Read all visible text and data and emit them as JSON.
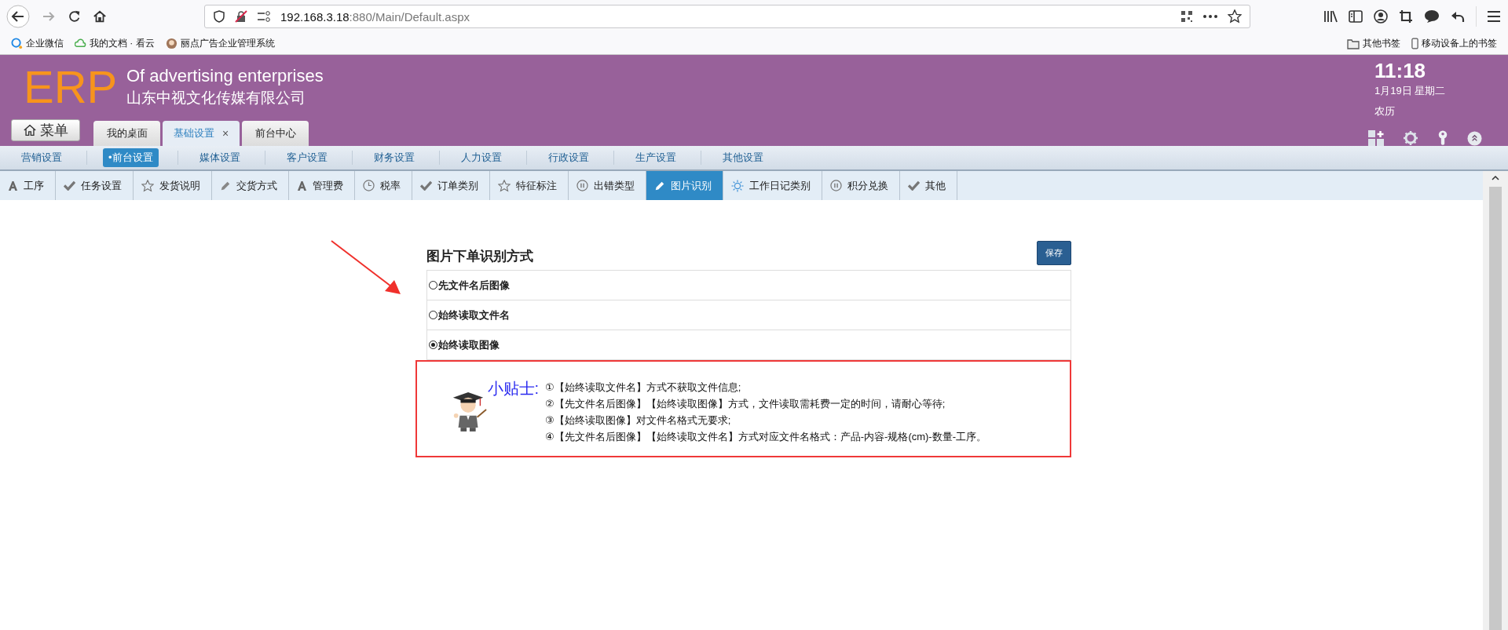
{
  "browser": {
    "url_host": "192.168.3.18",
    "url_path": ":880/Main/Default.aspx",
    "bookmarks": [
      {
        "label": "企业微信",
        "kind": "chat"
      },
      {
        "label": "我的文档 · 看云",
        "kind": "cloud"
      },
      {
        "label": "丽点广告企业管理系统",
        "kind": "site"
      }
    ],
    "bookmarks_right": [
      {
        "label": "其他书签",
        "kind": "folder"
      },
      {
        "label": "移动设备上的书签",
        "kind": "phone"
      }
    ]
  },
  "header": {
    "logo": "ERP",
    "title": "Of advertising enterprises",
    "company": "山东中视文化传媒有限公司",
    "time": "11:18",
    "date": "1月19日 星期二",
    "lunar": "农历",
    "menu_button": "菜单"
  },
  "tabs": [
    {
      "label": "我的桌面",
      "selected": false
    },
    {
      "label": "基础设置",
      "selected": true,
      "close": "×"
    },
    {
      "label": "前台中心",
      "selected": false
    }
  ],
  "nav": [
    {
      "label": "营销设置",
      "selected": false
    },
    {
      "label": "•前台设置",
      "selected": true
    },
    {
      "label": "媒体设置",
      "selected": false
    },
    {
      "label": "客户设置",
      "selected": false
    },
    {
      "label": "财务设置",
      "selected": false
    },
    {
      "label": "人力设置",
      "selected": false
    },
    {
      "label": "行政设置",
      "selected": false
    },
    {
      "label": "生产设置",
      "selected": false
    },
    {
      "label": "其他设置",
      "selected": false
    }
  ],
  "subtabs": [
    {
      "label": "工序",
      "kind": "font",
      "selected": false
    },
    {
      "label": "任务设置",
      "kind": "check",
      "selected": false
    },
    {
      "label": "发货说明",
      "kind": "star",
      "selected": false
    },
    {
      "label": "交货方式",
      "kind": "pencil",
      "selected": false
    },
    {
      "label": "管理费",
      "kind": "font",
      "selected": false
    },
    {
      "label": "税率",
      "kind": "clock",
      "selected": false
    },
    {
      "label": "订单类别",
      "kind": "check",
      "selected": false
    },
    {
      "label": "特征标注",
      "kind": "star",
      "selected": false
    },
    {
      "label": "出错类型",
      "kind": "pause",
      "selected": false
    },
    {
      "label": "图片识别",
      "kind": "pencil",
      "selected": true
    },
    {
      "label": "工作日记类别",
      "kind": "sun",
      "selected": false
    },
    {
      "label": "积分兑换",
      "kind": "pause",
      "selected": false
    },
    {
      "label": "其他",
      "kind": "check",
      "selected": false
    }
  ],
  "form": {
    "title": "图片下单识别方式",
    "save_button": "保存",
    "options": [
      {
        "label": "先文件名后图像",
        "selected": false
      },
      {
        "label": "始终读取文件名",
        "selected": false
      },
      {
        "label": "始终读取图像",
        "selected": true
      }
    ]
  },
  "tips": {
    "label": "小贴士:",
    "lines": [
      "①【始终读取文件名】方式不获取文件信息;",
      "②【先文件名后图像】【始终读取图像】方式，文件读取需耗费一定的时间，请耐心等待;",
      "③【始终读取图像】对文件名格式无要求;",
      "④【先文件名后图像】【始终读取文件名】方式对应文件名格式：产品-内容-规格(cm)-数量-工序。"
    ]
  }
}
